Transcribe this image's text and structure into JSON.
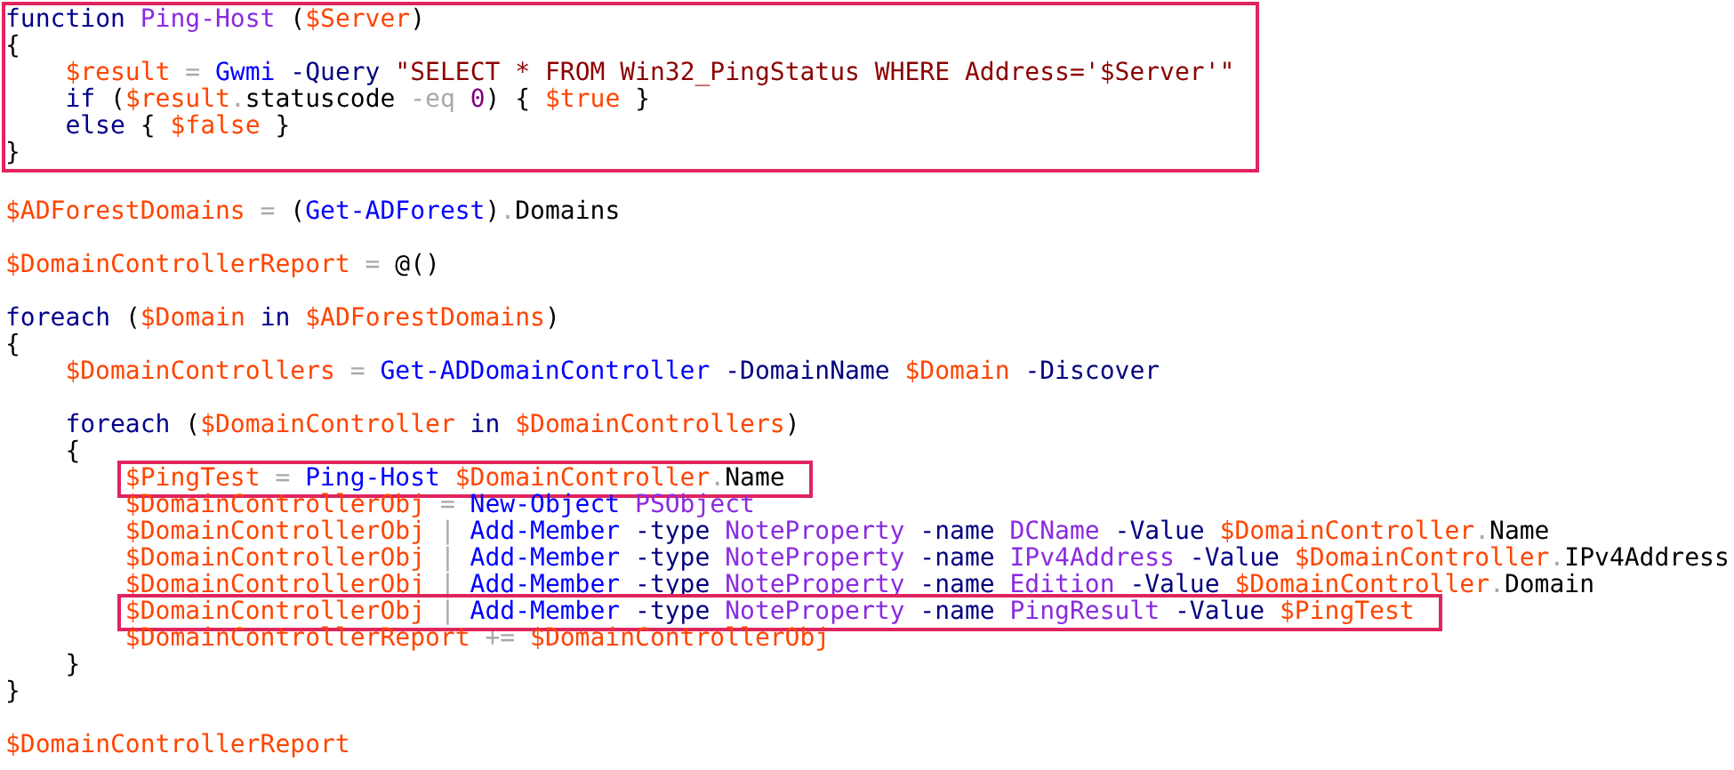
{
  "sections": [
    {
      "boxed": true,
      "lines": [
        {
          "boxed": false,
          "tokens": [
            {
              "kind": "keyword",
              "text": "function "
            },
            {
              "kind": "function",
              "text": "Ping-Host "
            },
            {
              "kind": "group",
              "text": "("
            },
            {
              "kind": "variable",
              "text": "$Server"
            },
            {
              "kind": "group",
              "text": ")"
            }
          ]
        },
        {
          "boxed": false,
          "tokens": [
            {
              "kind": "group",
              "text": "{"
            }
          ],
          "children": [
            {
              "boxed": false,
              "tokens": [
                {
                  "kind": "variable",
                  "text": "$result "
                },
                {
                  "kind": "operator",
                  "text": "= "
                },
                {
                  "kind": "command",
                  "text": "Gwmi "
                },
                {
                  "kind": "parameter",
                  "text": "-Query "
                },
                {
                  "kind": "string",
                  "text": "\"SELECT * FROM Win32_PingStatus WHERE Address='$Server'\""
                }
              ]
            },
            {
              "boxed": false,
              "tokens": [
                {
                  "kind": "keyword",
                  "text": "if "
                },
                {
                  "kind": "group",
                  "text": "("
                },
                {
                  "kind": "variable",
                  "text": "$result"
                },
                {
                  "kind": "operator",
                  "text": "."
                },
                {
                  "kind": "member",
                  "text": "statuscode "
                },
                {
                  "kind": "operator",
                  "text": "-eq "
                },
                {
                  "kind": "number",
                  "text": "0"
                },
                {
                  "kind": "group",
                  "text": ") { "
                },
                {
                  "kind": "variable",
                  "text": "$true "
                },
                {
                  "kind": "group",
                  "text": "}"
                }
              ]
            },
            {
              "boxed": false,
              "tokens": [
                {
                  "kind": "keyword",
                  "text": "else "
                },
                {
                  "kind": "group",
                  "text": "{ "
                },
                {
                  "kind": "variable",
                  "text": "$false "
                },
                {
                  "kind": "group",
                  "text": "}"
                }
              ]
            }
          ]
        },
        {
          "boxed": false,
          "tokens": [
            {
              "kind": "group",
              "text": "}"
            }
          ]
        }
      ]
    },
    {
      "boxed": false,
      "lines": [
        {
          "boxed": false
        },
        {
          "boxed": false,
          "tokens": [
            {
              "kind": "variable",
              "text": "$ADForestDomains "
            },
            {
              "kind": "operator",
              "text": "= "
            },
            {
              "kind": "group",
              "text": "("
            },
            {
              "kind": "command",
              "text": "Get-ADForest"
            },
            {
              "kind": "group",
              "text": ")"
            },
            {
              "kind": "operator",
              "text": "."
            },
            {
              "kind": "member",
              "text": "Domains"
            }
          ]
        },
        {
          "boxed": false
        },
        {
          "boxed": false,
          "tokens": [
            {
              "kind": "variable",
              "text": "$DomainControllerReport "
            },
            {
              "kind": "operator",
              "text": "= "
            },
            {
              "kind": "group",
              "text": "@()"
            }
          ]
        },
        {
          "boxed": false
        },
        {
          "boxed": false,
          "tokens": [
            {
              "kind": "keyword",
              "text": "foreach "
            },
            {
              "kind": "group",
              "text": "("
            },
            {
              "kind": "variable",
              "text": "$Domain "
            },
            {
              "kind": "keyword",
              "text": "in "
            },
            {
              "kind": "variable",
              "text": "$ADForestDomains"
            },
            {
              "kind": "group",
              "text": ")"
            }
          ]
        },
        {
          "boxed": false,
          "tokens": [
            {
              "kind": "group",
              "text": "{"
            }
          ],
          "children": [
            {
              "boxed": false,
              "tokens": [
                {
                  "kind": "variable",
                  "text": "$DomainControllers "
                },
                {
                  "kind": "operator",
                  "text": "= "
                },
                {
                  "kind": "command",
                  "text": "Get-ADDomainController "
                },
                {
                  "kind": "parameter",
                  "text": "-DomainName "
                },
                {
                  "kind": "variable",
                  "text": "$Domain "
                },
                {
                  "kind": "parameter",
                  "text": "-Discover"
                }
              ]
            },
            {
              "boxed": false
            },
            {
              "boxed": false,
              "tokens": [
                {
                  "kind": "keyword",
                  "text": "foreach "
                },
                {
                  "kind": "group",
                  "text": "("
                },
                {
                  "kind": "variable",
                  "text": "$DomainController "
                },
                {
                  "kind": "keyword",
                  "text": "in "
                },
                {
                  "kind": "variable",
                  "text": "$DomainControllers"
                },
                {
                  "kind": "group",
                  "text": ")"
                }
              ]
            },
            {
              "boxed": false,
              "tokens": [
                {
                  "kind": "group",
                  "text": "{"
                }
              ],
              "children": [
                {
                  "boxed": true,
                  "tokens": [
                    {
                      "kind": "variable",
                      "text": "$PingTest "
                    },
                    {
                      "kind": "operator",
                      "text": "= "
                    },
                    {
                      "kind": "command",
                      "text": "Ping-Host "
                    },
                    {
                      "kind": "variable",
                      "text": "$DomainController"
                    },
                    {
                      "kind": "operator",
                      "text": "."
                    },
                    {
                      "kind": "member",
                      "text": "Name"
                    }
                  ]
                },
                {
                  "boxed": false,
                  "tokens": [
                    {
                      "kind": "variable",
                      "text": "$DomainControllerObj "
                    },
                    {
                      "kind": "operator",
                      "text": "= "
                    },
                    {
                      "kind": "command",
                      "text": "New-Object "
                    },
                    {
                      "kind": "argument",
                      "text": "PSObject"
                    }
                  ]
                },
                {
                  "boxed": false,
                  "tokens": [
                    {
                      "kind": "variable",
                      "text": "$DomainControllerObj "
                    },
                    {
                      "kind": "operator",
                      "text": "| "
                    },
                    {
                      "kind": "command",
                      "text": "Add-Member "
                    },
                    {
                      "kind": "parameter",
                      "text": "-type "
                    },
                    {
                      "kind": "argument",
                      "text": "NoteProperty "
                    },
                    {
                      "kind": "parameter",
                      "text": "-name "
                    },
                    {
                      "kind": "argument",
                      "text": "DCName "
                    },
                    {
                      "kind": "parameter",
                      "text": "-Value "
                    },
                    {
                      "kind": "variable",
                      "text": "$DomainController"
                    },
                    {
                      "kind": "operator",
                      "text": "."
                    },
                    {
                      "kind": "member",
                      "text": "Name"
                    }
                  ]
                },
                {
                  "boxed": false,
                  "tokens": [
                    {
                      "kind": "variable",
                      "text": "$DomainControllerObj "
                    },
                    {
                      "kind": "operator",
                      "text": "| "
                    },
                    {
                      "kind": "command",
                      "text": "Add-Member "
                    },
                    {
                      "kind": "parameter",
                      "text": "-type "
                    },
                    {
                      "kind": "argument",
                      "text": "NoteProperty "
                    },
                    {
                      "kind": "parameter",
                      "text": "-name "
                    },
                    {
                      "kind": "argument",
                      "text": "IPv4Address "
                    },
                    {
                      "kind": "parameter",
                      "text": "-Value "
                    },
                    {
                      "kind": "variable",
                      "text": "$DomainController"
                    },
                    {
                      "kind": "operator",
                      "text": "."
                    },
                    {
                      "kind": "member",
                      "text": "IPv4Address"
                    }
                  ]
                },
                {
                  "boxed": false,
                  "tokens": [
                    {
                      "kind": "variable",
                      "text": "$DomainControllerObj "
                    },
                    {
                      "kind": "operator",
                      "text": "| "
                    },
                    {
                      "kind": "command",
                      "text": "Add-Member "
                    },
                    {
                      "kind": "parameter",
                      "text": "-type "
                    },
                    {
                      "kind": "argument",
                      "text": "NoteProperty "
                    },
                    {
                      "kind": "parameter",
                      "text": "-name "
                    },
                    {
                      "kind": "argument",
                      "text": "Edition "
                    },
                    {
                      "kind": "parameter",
                      "text": "-Value "
                    },
                    {
                      "kind": "variable",
                      "text": "$DomainController"
                    },
                    {
                      "kind": "operator",
                      "text": "."
                    },
                    {
                      "kind": "member",
                      "text": "Domain"
                    }
                  ]
                },
                {
                  "boxed": true,
                  "tokens": [
                    {
                      "kind": "variable",
                      "text": "$DomainControllerObj "
                    },
                    {
                      "kind": "operator",
                      "text": "| "
                    },
                    {
                      "kind": "command",
                      "text": "Add-Member "
                    },
                    {
                      "kind": "parameter",
                      "text": "-type "
                    },
                    {
                      "kind": "argument",
                      "text": "NoteProperty "
                    },
                    {
                      "kind": "parameter",
                      "text": "-name "
                    },
                    {
                      "kind": "argument",
                      "text": "PingResult "
                    },
                    {
                      "kind": "parameter",
                      "text": "-Value "
                    },
                    {
                      "kind": "variable",
                      "text": "$PingTest"
                    }
                  ]
                },
                {
                  "boxed": false,
                  "tokens": [
                    {
                      "kind": "variable",
                      "text": "$DomainControllerReport "
                    },
                    {
                      "kind": "operator",
                      "text": "+= "
                    },
                    {
                      "kind": "variable",
                      "text": "$DomainControllerObj"
                    }
                  ]
                }
              ]
            },
            {
              "boxed": false,
              "tokens": [
                {
                  "kind": "group",
                  "text": "}"
                }
              ]
            }
          ]
        },
        {
          "boxed": false,
          "tokens": [
            {
              "kind": "group",
              "text": "}"
            }
          ]
        },
        {
          "boxed": false
        },
        {
          "boxed": false,
          "tokens": [
            {
              "kind": "variable",
              "text": "$DomainControllerReport"
            }
          ]
        }
      ]
    }
  ]
}
